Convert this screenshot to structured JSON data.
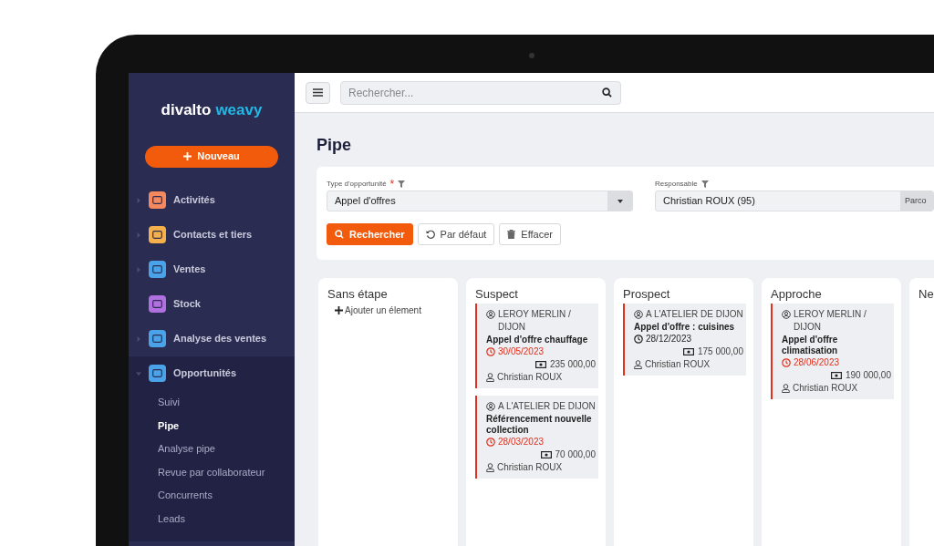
{
  "sidebar": {
    "logo": {
      "part_1": "divalto",
      "part_2": "weavy"
    },
    "new_button": "Nouveau",
    "items": [
      {
        "label": "Activités",
        "kind": "group",
        "color": "#f4895f",
        "expanded": false
      },
      {
        "label": "Contacts et tiers",
        "kind": "group",
        "color": "#f5b04c",
        "expanded": false
      },
      {
        "label": "Ventes",
        "kind": "group",
        "color": "#4aa3e8",
        "expanded": false
      },
      {
        "label": "Stock",
        "kind": "link",
        "color": "#b070e0",
        "expanded": false
      },
      {
        "label": "Analyse des ventes",
        "kind": "group",
        "color": "#4aa3e8",
        "expanded": false
      },
      {
        "label": "Opportunités",
        "kind": "group",
        "color": "#4aa3e8",
        "expanded": true,
        "children": [
          {
            "label": "Suivi",
            "selected": false
          },
          {
            "label": "Pipe",
            "selected": true
          },
          {
            "label": "Analyse pipe",
            "selected": false
          },
          {
            "label": "Revue par collaborateur",
            "selected": false
          },
          {
            "label": "Concurrents",
            "selected": false
          },
          {
            "label": "Leads",
            "selected": false
          }
        ]
      }
    ]
  },
  "topbar": {
    "search": {
      "placeholder": "Rechercher..."
    }
  },
  "page": {
    "title": "Pipe",
    "filters": [
      {
        "label": "Type d'opportunité",
        "required_mark": "*",
        "value": "Appel d'offres",
        "kind": "select"
      },
      {
        "label": "Responsable",
        "value": "Christian ROUX (95)",
        "kind": "lookup",
        "button": "Parco"
      }
    ],
    "buttons": [
      {
        "label": "Rechercher",
        "kind": "primary"
      },
      {
        "label": "Par défaut",
        "kind": "reset"
      },
      {
        "label": "Effacer",
        "kind": "clear"
      }
    ],
    "columns": [
      {
        "title": "Sans étape",
        "add_label": "Ajouter un élement"
      },
      {
        "title": "Suspect",
        "cards": [
          {
            "company": "LEROY MERLIN / DIJON",
            "title": "Appel d'offre chauffage",
            "date": "30/05/2023",
            "overdue": true,
            "amount": "235 000,00",
            "owner": "Christian ROUX"
          },
          {
            "company": "A L'ATELIER DE DIJON",
            "title": "Référencement nouvelle collection",
            "date": "28/03/2023",
            "overdue": true,
            "amount": "70 000,00",
            "owner": "Christian ROUX"
          }
        ]
      },
      {
        "title": "Prospect",
        "cards": [
          {
            "company": "A L'ATELIER DE DIJON",
            "title": "Appel d'offre : cuisines",
            "date": "28/12/2023",
            "overdue": false,
            "amount": "175 000,00",
            "owner": "Christian ROUX"
          }
        ]
      },
      {
        "title": "Approche",
        "cards": [
          {
            "company": "LEROY MERLIN / DIJON",
            "title": "Appel d'offre climatisation",
            "date": "28/06/2023",
            "overdue": true,
            "amount": "190 000,00",
            "owner": "Christian ROUX"
          }
        ]
      },
      {
        "title": "Ne"
      }
    ]
  }
}
